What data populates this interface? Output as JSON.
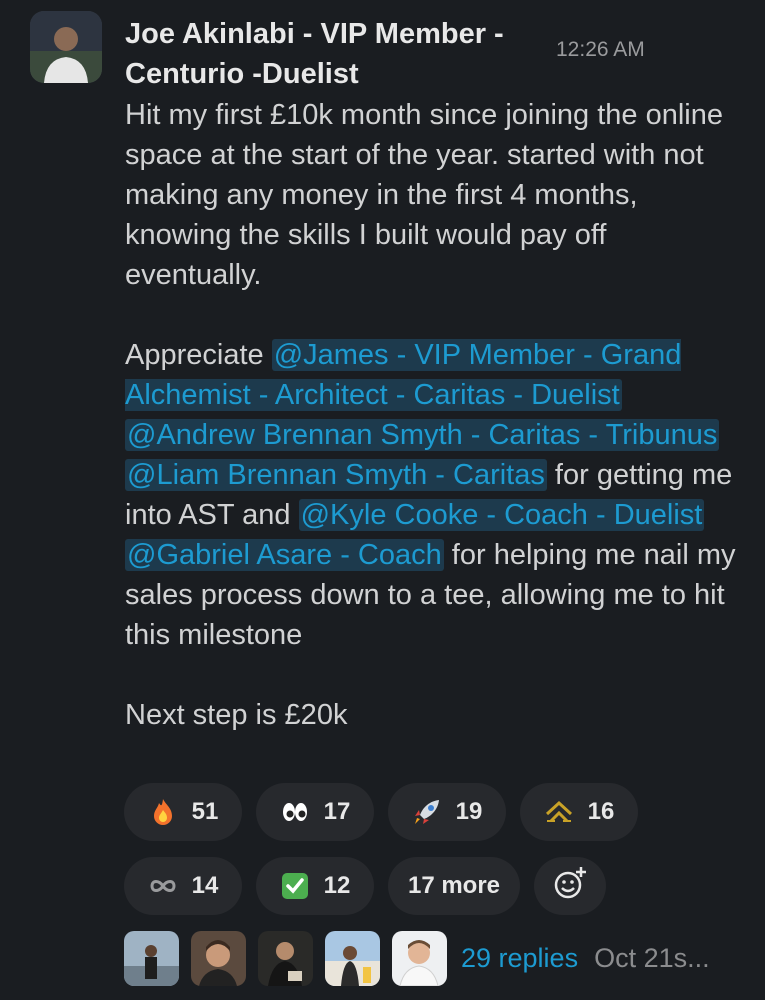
{
  "message": {
    "author": "Joe Akinlabi - VIP Member - Centurio -Duelist",
    "time": "12:26 AM",
    "p1": "Hit my first £10k month since joining the online space at the start of the year. started with not making any money in the first 4 months, knowing the skills I built would pay off eventually.",
    "p2_start": "Appreciate ",
    "mention1": "@James - VIP Member - Grand Alchemist - Architect - Caritas - Duelist",
    "mention2": "@Andrew Brennan Smyth - Caritas - Tribunus",
    "mention3": "@Liam Brennan Smyth - Caritas",
    "p2_mid": " for getting me into AST and ",
    "mention4": "@Kyle Cooke - Coach - Duelist",
    "mention5": "@Gabriel Asare - Coach",
    "p2_end": " for helping me nail my sales process down to a tee, allowing me to hit this milestone",
    "p3": "Next step is £20k"
  },
  "reactions": [
    {
      "icon": "fire-emoji",
      "count": "51"
    },
    {
      "icon": "eyes-emoji",
      "count": "17"
    },
    {
      "icon": "rocket-emoji",
      "count": "19"
    },
    {
      "icon": "ast-logo-emoji",
      "count": "16"
    },
    {
      "icon": "infinity-emoji",
      "count": "14"
    },
    {
      "icon": "check-mark-emoji",
      "count": "12"
    }
  ],
  "more_reactions": "17 more",
  "replies": {
    "count_label": "29 replies",
    "date_label": "Oct 21s..."
  }
}
